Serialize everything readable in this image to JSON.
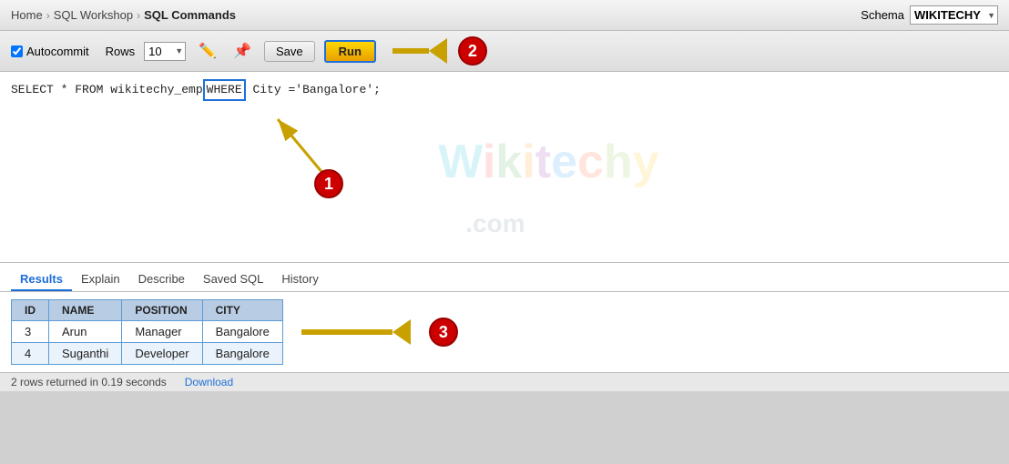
{
  "breadcrumb": {
    "home": "Home",
    "sql_workshop": "SQL Workshop",
    "sql_commands": "SQL Commands",
    "sep": "›"
  },
  "schema": {
    "label": "Schema",
    "value": "WIKITECHY"
  },
  "toolbar": {
    "autocommit_label": "Autocommit",
    "rows_label": "Rows",
    "rows_value": "10",
    "save_label": "Save",
    "run_label": "Run"
  },
  "editor": {
    "sql": "SELECT * FROM wikitechy_emp WHERE City ='Bangalore';"
  },
  "results_tabs": [
    "Results",
    "Explain",
    "Describe",
    "Saved SQL",
    "History"
  ],
  "active_tab": "Results",
  "table": {
    "headers": [
      "ID",
      "NAME",
      "POSITION",
      "CITY"
    ],
    "rows": [
      [
        "3",
        "Arun",
        "Manager",
        "Bangalore"
      ],
      [
        "4",
        "Suganthi",
        "Developer",
        "Bangalore"
      ]
    ]
  },
  "status": {
    "message": "2 rows returned in 0.19 seconds",
    "download_link": "Download"
  },
  "badges": {
    "1": "1",
    "2": "2",
    "3": "3"
  }
}
